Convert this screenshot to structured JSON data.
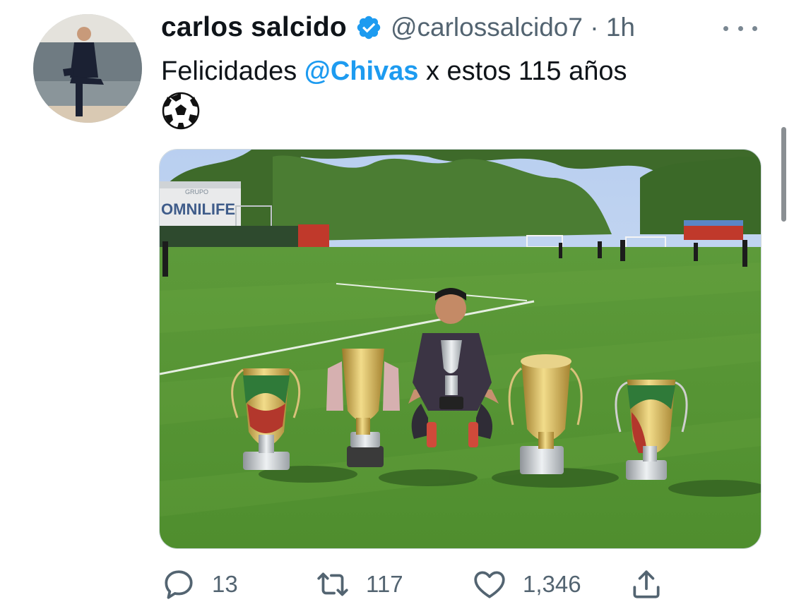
{
  "tweet": {
    "author_name": "carlos salcido",
    "handle_line": "@carlossalcido7 · 1h",
    "text_prefix": "Felicidades ",
    "mention": "@Chivas",
    "text_suffix": " x estos 115 años",
    "emoji_icon": "soccer-ball-icon",
    "image_banner": "OMNILIFE",
    "image_banner_sub": "GRUPO"
  },
  "actions": {
    "replies": "13",
    "retweets": "117",
    "likes": "1,346"
  },
  "colors": {
    "accent": "#1d9bf0",
    "muted": "#536471",
    "text": "#0f1419"
  }
}
